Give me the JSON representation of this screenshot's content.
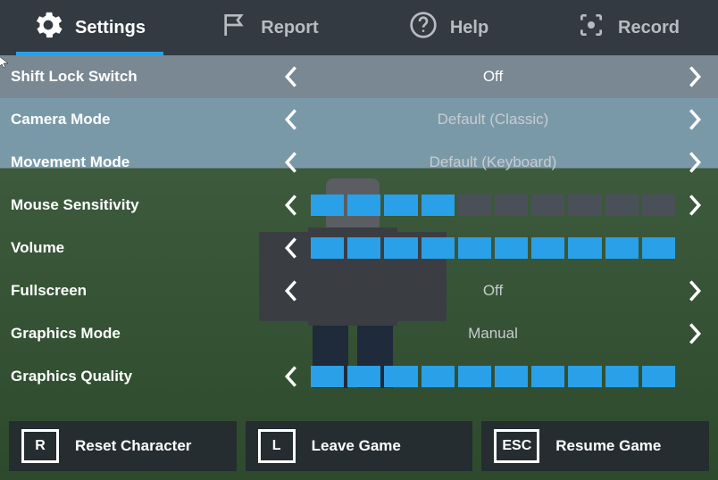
{
  "tabs": {
    "settings": "Settings",
    "report": "Report",
    "help": "Help",
    "record": "Record"
  },
  "settings": [
    {
      "label": "Shift Lock Switch",
      "kind": "text",
      "value": "Off",
      "highlighted": true
    },
    {
      "label": "Camera Mode",
      "kind": "text",
      "value": "Default (Classic)"
    },
    {
      "label": "Movement Mode",
      "kind": "text",
      "value": "Default (Keyboard)"
    },
    {
      "label": "Mouse Sensitivity",
      "kind": "slider",
      "filled": 4,
      "total": 10
    },
    {
      "label": "Volume",
      "kind": "slider",
      "filled": 10,
      "total": 10,
      "hideRight": true
    },
    {
      "label": "Fullscreen",
      "kind": "text",
      "value": "Off"
    },
    {
      "label": "Graphics Mode",
      "kind": "text",
      "value": "Manual",
      "hideLeft": true
    },
    {
      "label": "Graphics Quality",
      "kind": "slider",
      "filled": 10,
      "total": 10,
      "hideRight": true
    }
  ],
  "footer": {
    "reset": {
      "key": "R",
      "label": "Reset Character"
    },
    "leave": {
      "key": "L",
      "label": "Leave Game"
    },
    "resume": {
      "key": "ESC",
      "label": "Resume Game"
    }
  }
}
